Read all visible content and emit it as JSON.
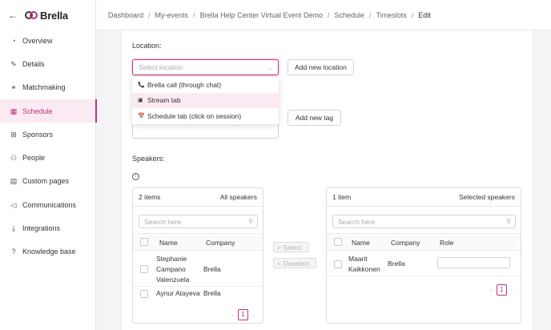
{
  "brand": {
    "name": "Brella"
  },
  "nav": [
    {
      "label": "Overview",
      "icon": "◔"
    },
    {
      "label": "Details",
      "icon": "✎"
    },
    {
      "label": "Matchmaking",
      "icon": "⚭"
    },
    {
      "label": "Schedule",
      "icon": "▦"
    },
    {
      "label": "Sponsors",
      "icon": "⊞"
    },
    {
      "label": "People",
      "icon": "⚇"
    },
    {
      "label": "Custom pages",
      "icon": "▤"
    },
    {
      "label": "Communications",
      "icon": "◁"
    },
    {
      "label": "Integrations",
      "icon": "⤓"
    },
    {
      "label": "Knowledge base",
      "icon": "?"
    }
  ],
  "breadcrumb": [
    "Dashboard",
    "My-events",
    "Brella Help Center Virtual Event Demo",
    "Schedule",
    "Timeslots",
    "Edit"
  ],
  "form": {
    "location_label": "Location",
    "location_placeholder": "Select location",
    "location_options": [
      {
        "label": "Brella call (through chat)",
        "icon": "📞"
      },
      {
        "label": "Stream tab",
        "icon": "▣"
      },
      {
        "label": "Schedule tab (click on session)",
        "icon": "📅"
      }
    ],
    "add_location": "Add new location",
    "add_tag": "Add new tag",
    "speakers_label": "Speakers"
  },
  "left_panel": {
    "count": "2 items",
    "title": "All speakers",
    "search_placeholder": "Search here",
    "col_name": "Name",
    "col_company": "Company",
    "rows": [
      {
        "name_l1": "Stephanie",
        "name_l2": "Campano",
        "name_l3": "Valenzuela",
        "company": "Brella"
      },
      {
        "name": "Aynur Atayeva",
        "company": "Brella"
      }
    ],
    "page": "1"
  },
  "transfer": {
    "select": "Select",
    "deselect": "Deselect"
  },
  "right_panel": {
    "count": "1 item",
    "title": "Selected speakers",
    "search_placeholder": "Search here",
    "col_name": "Name",
    "col_company": "Company",
    "col_role": "Role",
    "rows": [
      {
        "name_l1": "Maarit",
        "name_l2": "Kaikkonen",
        "company": "Brella"
      }
    ],
    "page": "1"
  }
}
